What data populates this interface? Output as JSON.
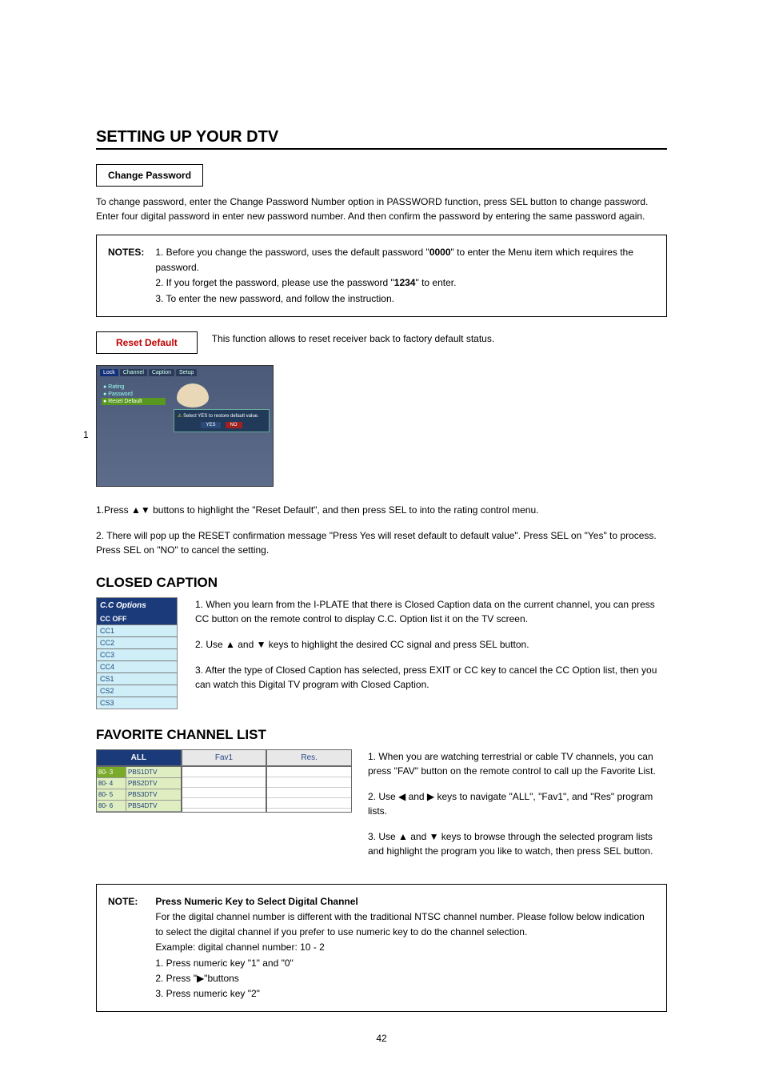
{
  "page_title": "SETTING UP YOUR DTV",
  "change_password": {
    "label": "Change Password",
    "body": "To change password, enter the Change Password Number option in PASSWORD function, press SEL button to change password. Enter four digital password in enter new password number. And then confirm the password by entering the same password again."
  },
  "notes": {
    "label": "NOTES:",
    "n1_pre": "1. Before you change the password, uses the default password \"",
    "n1_bold": "0000",
    "n1_post": "\" to enter the Menu item which requires the password.",
    "n2_pre": "2. If you forget the password, please use the password \"",
    "n2_bold": "1234",
    "n2_post": "\" to enter.",
    "n3": "3. To enter the new password, and follow the instruction."
  },
  "reset": {
    "label": "Reset Default",
    "desc": "This function allows to reset receiver back to factory default status.",
    "screenshot": {
      "tabs": [
        "Lock",
        "Channel",
        "Caption",
        "Setup"
      ],
      "side": [
        "Rating",
        "Password",
        "Reset Default"
      ],
      "dialog": "Select YES to restore default value.",
      "yes": "YES",
      "no": "NO"
    },
    "side_num": "1",
    "step1": "1.Press ▲▼ buttons to highlight the \"Reset Default\", and then press SEL to into the rating control menu.",
    "step2": "2. There will pop up the RESET confirmation message \"Press Yes will reset default to default value\". Press SEL on \"Yes\" to process. Press SEL on \"NO\" to cancel the setting."
  },
  "closed_caption": {
    "heading": "CLOSED CAPTION",
    "panel_head": "C.C  Options",
    "items": [
      "CC  OFF",
      "CC1",
      "CC2",
      "CC3",
      "CC4",
      "CS1",
      "CS2",
      "CS3"
    ],
    "p1": "1. When you learn from the I-PLATE that there is Closed Caption data on the current channel, you can press CC button on the remote control to display C.C. Option list it on the TV screen.",
    "p2": "2. Use ▲ and ▼ keys to highlight the desired CC signal and press SEL button.",
    "p3": "3. After the type of Closed Caption has selected, press EXIT or CC key to cancel the CC Option list, then you can watch this Digital TV program with Closed Caption."
  },
  "favorite": {
    "heading": "FAVORITE CHANNEL LIST",
    "tabs": [
      "ALL",
      "Fav1",
      "Res."
    ],
    "rows": [
      {
        "ch": "80- 3",
        "name": "PBS1DTV"
      },
      {
        "ch": "80- 4",
        "name": "PBS2DTV"
      },
      {
        "ch": "80- 5",
        "name": "PBS3DTV"
      },
      {
        "ch": "80- 6",
        "name": "PBS4DTV"
      }
    ],
    "p1": "1. When you are watching terrestrial or cable TV channels, you can press \"FAV\" button on the remote control to call up the Favorite List.",
    "p2": "2. Use ◀ and ▶ keys to navigate \"ALL\", \"Fav1\", and \"Res\" program lists.",
    "p3": "3. Use ▲ and ▼ keys to browse through the selected program lists and highlight the program you like to watch, then press SEL button."
  },
  "note2": {
    "label": "NOTE:",
    "title": "Press Numeric Key to Select Digital Channel",
    "l1": "For the digital channel number is different with the traditional NTSC channel number. Please follow below indication to select the digital channel if you prefer to use numeric key to do the channel selection.",
    "l2": "Example: digital channel number: 10 - 2",
    "l3": "1. Press numeric key \"1\" and \"0\"",
    "l4": "2. Press \"▶\"buttons",
    "l5": "3. Press numeric key \"2\""
  },
  "page_num": "42"
}
